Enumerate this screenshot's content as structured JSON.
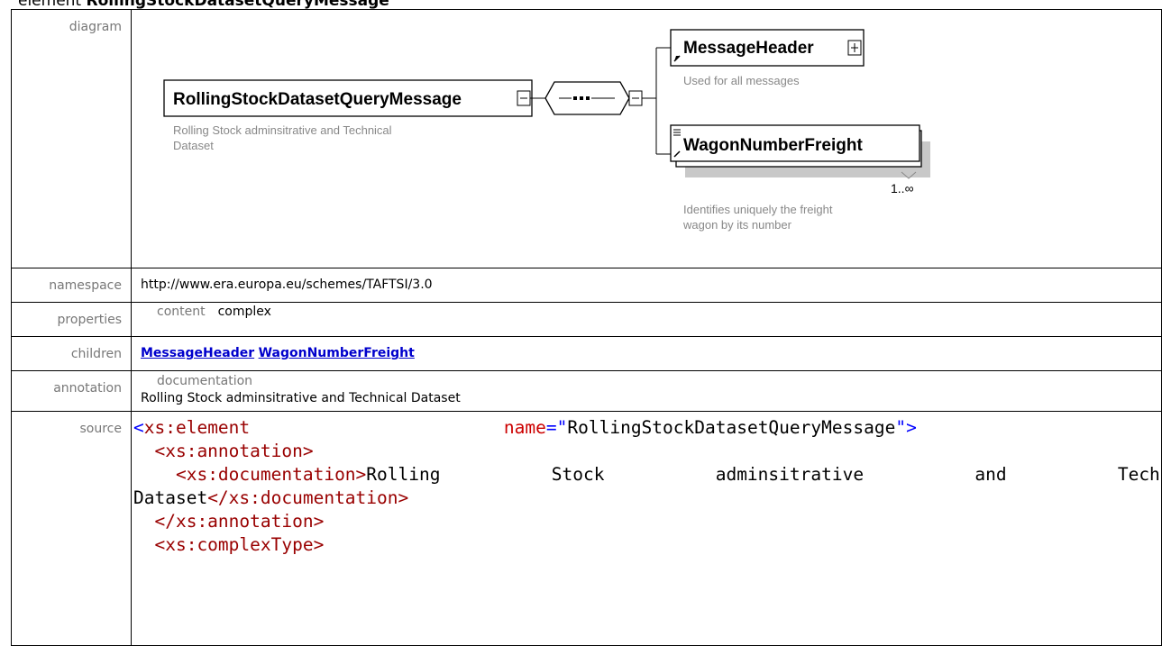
{
  "heading": {
    "prefix": "element ",
    "name": "RollingStockDatasetQueryMessage"
  },
  "rows": {
    "diagram_label": "diagram",
    "namespace_label": "namespace",
    "properties_label": "properties",
    "children_label": "children",
    "annotation_label": "annotation",
    "source_label": "source"
  },
  "diagram": {
    "root_name": "RollingStockDatasetQueryMessage",
    "root_doc_line1": "Rolling Stock adminsitrative and Technical",
    "root_doc_line2": "Dataset",
    "child1_name": "MessageHeader",
    "child1_doc": "Used for all messages",
    "child2_name": "WagonNumberFreight",
    "child2_occurs": "1..∞",
    "child2_doc_line1": "Identifies uniquely the freight",
    "child2_doc_line2": "wagon by its number"
  },
  "namespace": "http://www.era.europa.eu/schemes/TAFTSI/3.0",
  "properties": {
    "key": "content",
    "value": "complex"
  },
  "children": [
    "MessageHeader",
    "WagonNumberFreight"
  ],
  "annotation": {
    "title": "documentation",
    "text": "Rolling Stock adminsitrative and Technical Dataset"
  },
  "source": {
    "l1_open": "<",
    "l1_tag": "xs:element",
    "l1_att": "name",
    "l1_eq": "=\"",
    "l1_val": "RollingStockDatasetQueryMessage",
    "l1_close": "\">",
    "l2": "<xs:annotation>",
    "l3_open": "<xs:documentation>",
    "l3_text": "Rolling Stock adminsitrative and Technical",
    "l4_text": "Dataset",
    "l4_close": "</xs:documentation>",
    "l5": "</xs:annotation>",
    "l6": "<xs:complexType>"
  },
  "colors": {
    "link": "#0000cc",
    "tag": "#990000",
    "bracket": "#0000ff",
    "attr": "#cc0000",
    "label": "#777777"
  }
}
